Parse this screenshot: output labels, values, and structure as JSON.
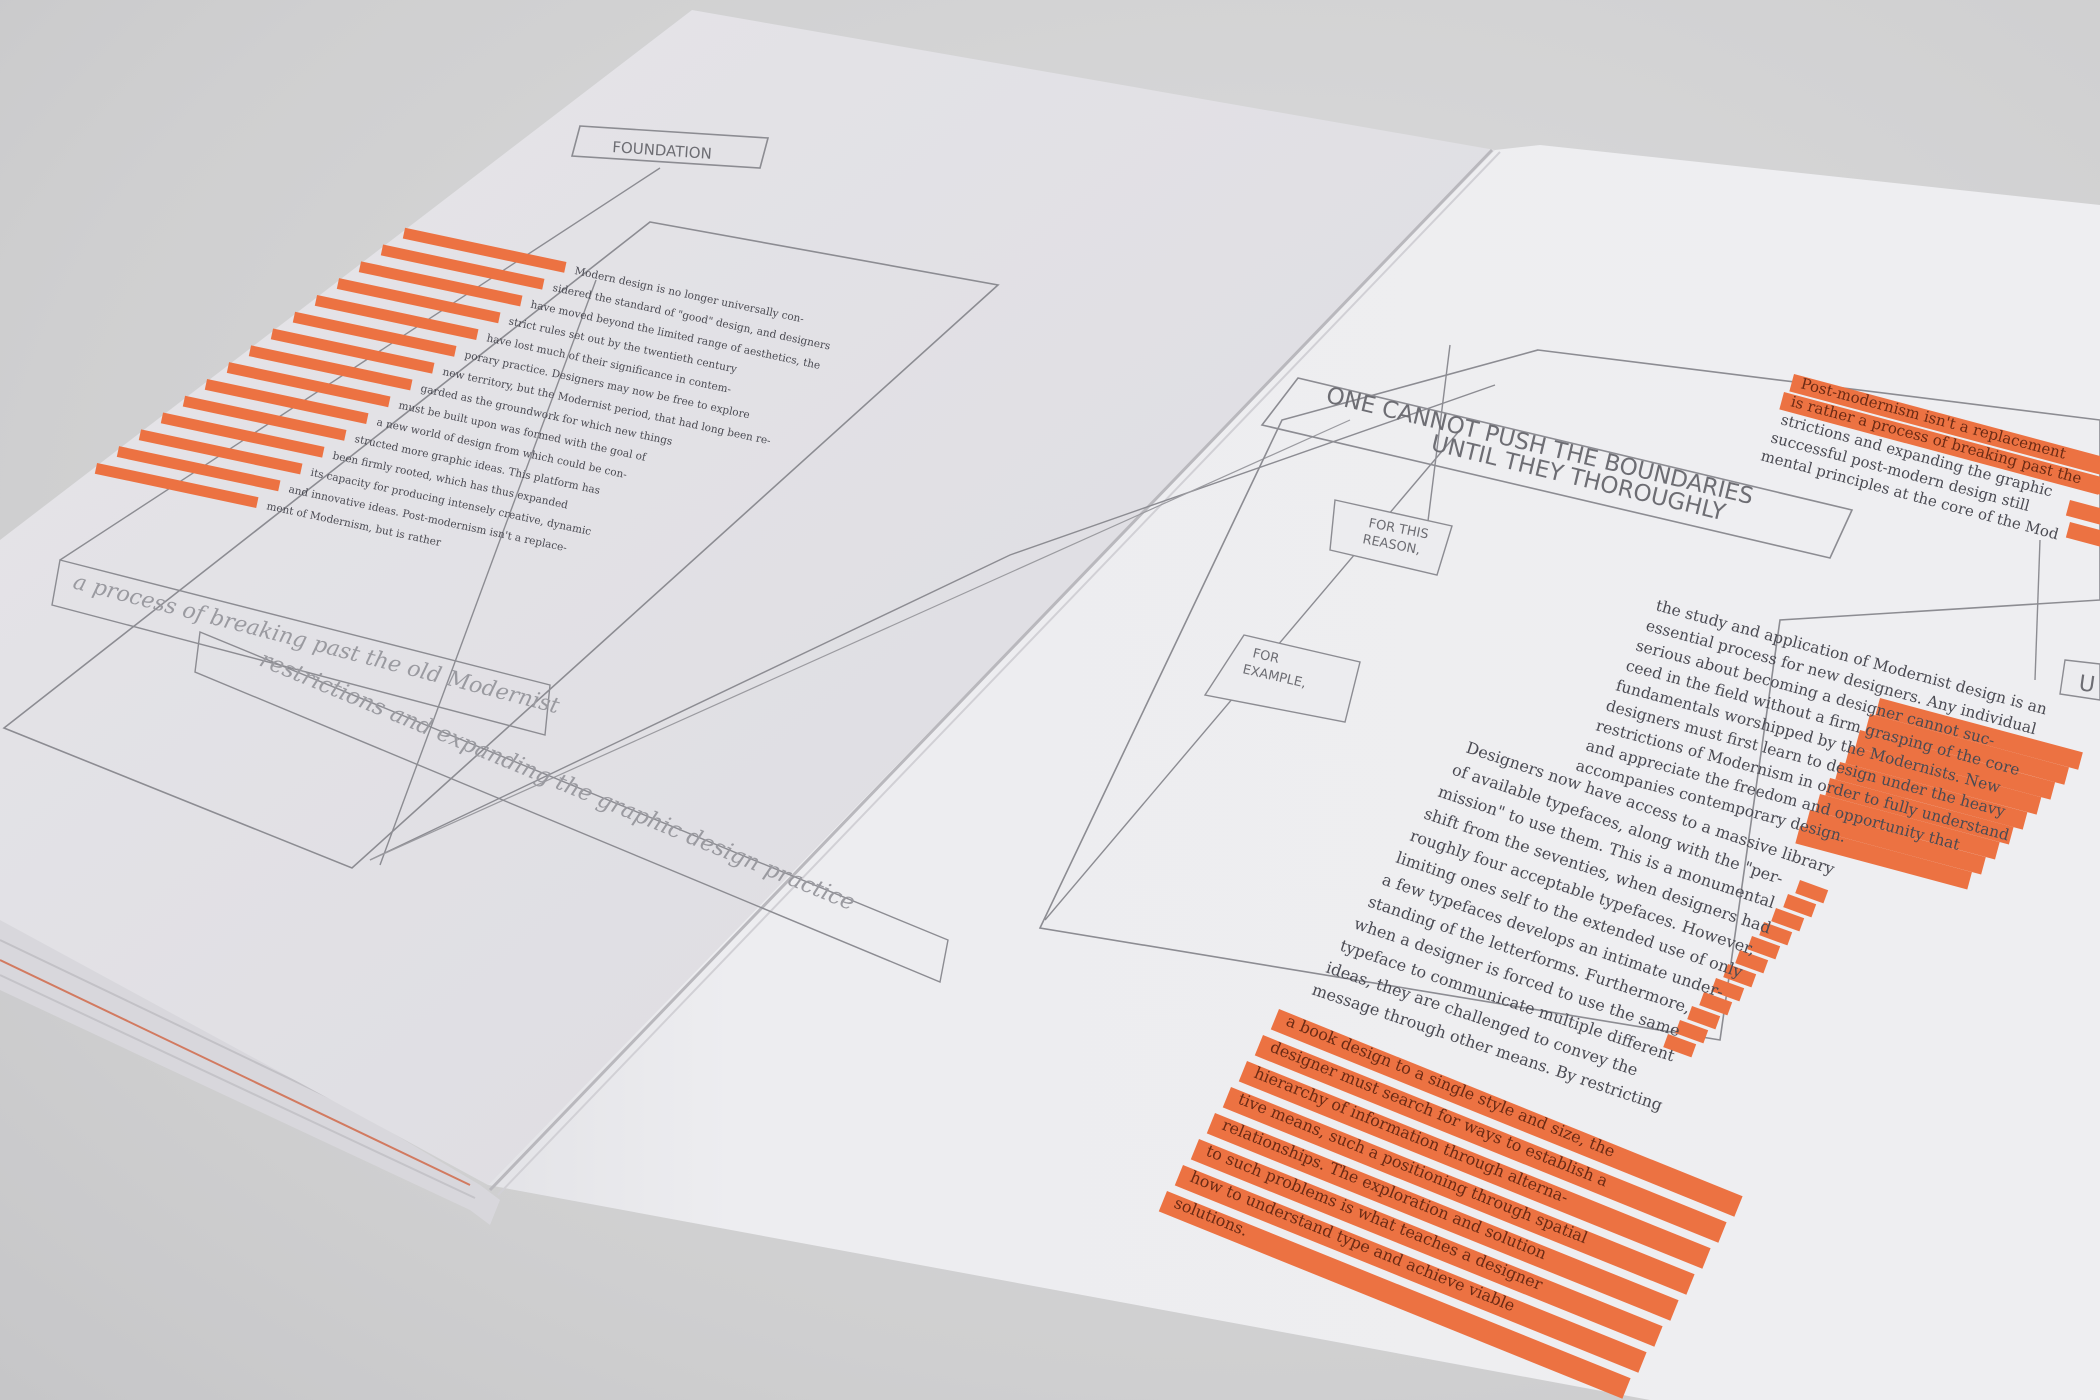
{
  "colors": {
    "paper_left": "#e3e2e6",
    "paper_right": "#ebebee",
    "accent_orange": "#ec7242",
    "rule_line": "#8a8a90",
    "table": "#cfcfd0"
  },
  "left_page": {
    "tab_label": "FOUNDATION",
    "body_lines": [
      "Modern design is no longer universally con-",
      "sidered the standard of \"good\" design, and designers",
      "have moved beyond the limited range of aesthetics, the",
      "strict rules set out by the twentieth century",
      "have lost much of their significance in contem-",
      "porary practice. Designers may now be free to explore",
      "new territory, but the Modernist period, that had long been re-",
      "garded as the groundwork for which new things",
      "must be built upon was formed with the goal of",
      "a new world of design from which could be con-",
      "structed more graphic ideas. This platform has",
      "been firmly rooted, which has thus expanded",
      "its capacity for producing intensely creative, dynamic",
      "and innovative ideas. Post-modernism isn't a replace-",
      "ment of Modernism, but is rather"
    ],
    "flowing_text_1": "a process of breaking past the old Modernist",
    "flowing_text_2": "restrictions and expanding the graphic design practice"
  },
  "right_page": {
    "headline_line1": "ONE CANNOT PUSH THE BOUNDARIES",
    "headline_line2": "UNTIL THEY THOROUGHLY",
    "box_reason": [
      "FOR THIS",
      "REASON,"
    ],
    "box_example": [
      "FOR",
      "EXAMPLE,"
    ],
    "box_u": "U",
    "top_right_lines": [
      "Post-modernism isn't a replacement",
      "is rather a process of breaking past the",
      "strictions and expanding the graphic",
      "successful post-modern design still",
      "mental principles at the core of the Mod"
    ],
    "paragraph_1": [
      "the study and application of Modernist design is an",
      "essential process for new designers. Any individual",
      "serious about becoming a designer cannot suc-",
      "ceed in the field without a firm grasping of the core",
      "fundamentals worshipped by the Modernists. New",
      "designers must first learn to design under the heavy",
      "restrictions of Modernism in order to fully understand",
      "and appreciate the freedom and opportunity that",
      "accompanies contemporary design."
    ],
    "paragraph_2": [
      "Designers now have access to a massive library",
      "of available typefaces, along with the \"per-",
      "mission\" to use them. This is a monumental",
      "shift from the seventies, when designers had",
      "roughly four acceptable typefaces. However,",
      "limiting ones self to the extended use of only",
      "a few typefaces develops an intimate under-",
      "standing of the letterforms. Furthermore,",
      "when a designer is forced to use the same",
      "typeface to communicate multiple different",
      "ideas, they are challenged to convey the",
      "message through other means. By restricting"
    ],
    "highlighted_lines": [
      "a book design to a single style and size, the",
      "designer must search for ways to establish a",
      "hierarchy of information through alterna-",
      "tive means, such a positioning through spatial",
      "relationships. The exploration and solution",
      "to such problems is what teaches a designer",
      "how to understand type and achieve viable",
      "solutions."
    ]
  }
}
